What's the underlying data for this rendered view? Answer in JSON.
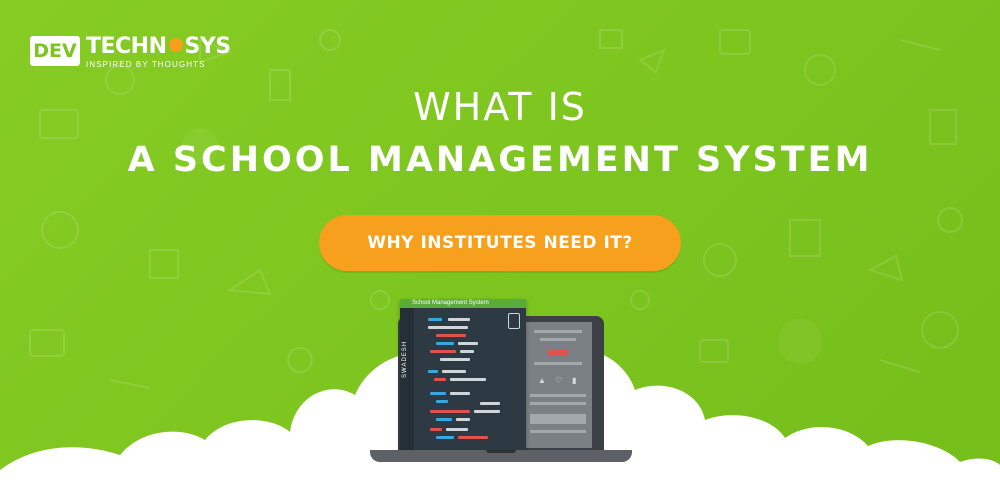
{
  "brand": {
    "logo_left": "DEV",
    "logo_main_a": "TECHN",
    "logo_main_b": "SYS",
    "tagline": "INSPIRED BY THOUGHTS"
  },
  "heading": {
    "line1": "WHAT IS",
    "line2": "A SCHOOL MANAGEMENT SYSTEM"
  },
  "cta": {
    "label": "WHY INSTITUTES NEED IT?"
  },
  "screen": {
    "window_title": "School Management System",
    "side_label": "SWADESH"
  },
  "colors": {
    "background": "#7cc41f",
    "accent": "#f7a01d",
    "text": "#ffffff"
  }
}
